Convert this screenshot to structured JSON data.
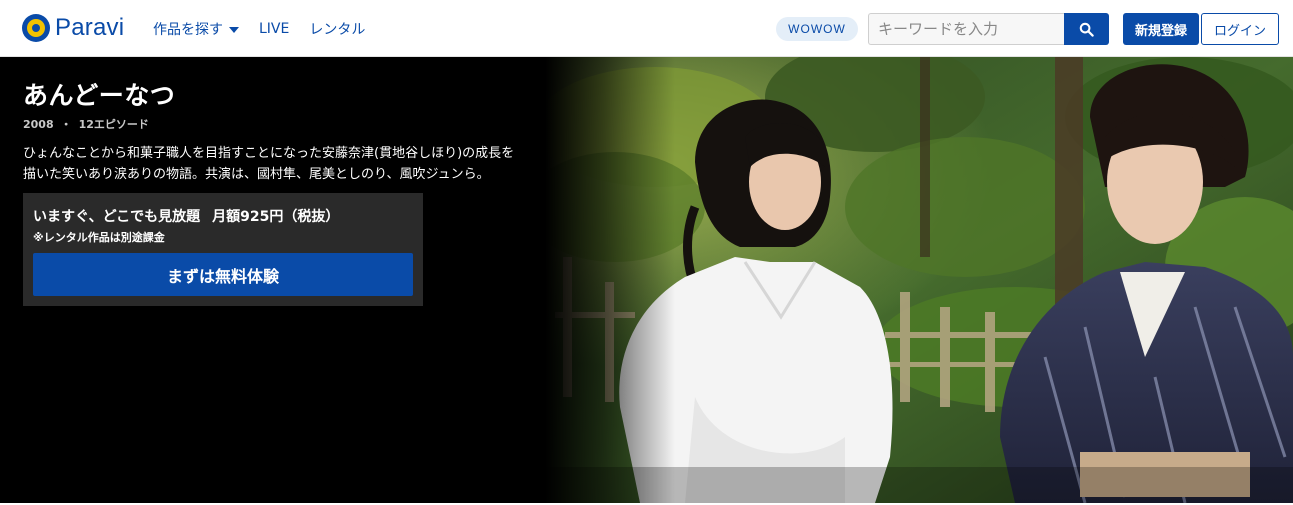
{
  "header": {
    "logo_text": "Paravi",
    "nav": [
      {
        "label": "作品を探す",
        "has_dropdown": true,
        "icon": "chevron-down-icon"
      },
      {
        "label": "LIVE"
      },
      {
        "label": "レンタル"
      }
    ],
    "wowow_badge": "WOWOW",
    "search": {
      "placeholder": "キーワードを入力",
      "value": "",
      "icon": "search-icon"
    },
    "signup_label": "新規登録",
    "login_label": "ログイン"
  },
  "hero": {
    "title": "あんどーなつ",
    "year": "2008",
    "separator": "・",
    "episodes": "12エピソード",
    "description": "ひょんなことから和菓子職人を目指すことになった安藤奈津(貫地谷しほり)の成長を描いた笑いあり涙ありの物語。共演は、國村隼、尾美としのり、風吹ジュンら。",
    "plan": {
      "title": "いますぐ、どこでも見放題",
      "price": "月額925円（税抜）",
      "note": "※レンタル作品は別途課金",
      "cta_label": "まずは無料体験"
    }
  },
  "colors": {
    "brand_blue": "#0a4ba8",
    "logo_yellow": "#f2c200",
    "hero_background": "#000000",
    "plan_box": "#2a2a2a",
    "wowow_badge_bg": "#e4eef8"
  }
}
